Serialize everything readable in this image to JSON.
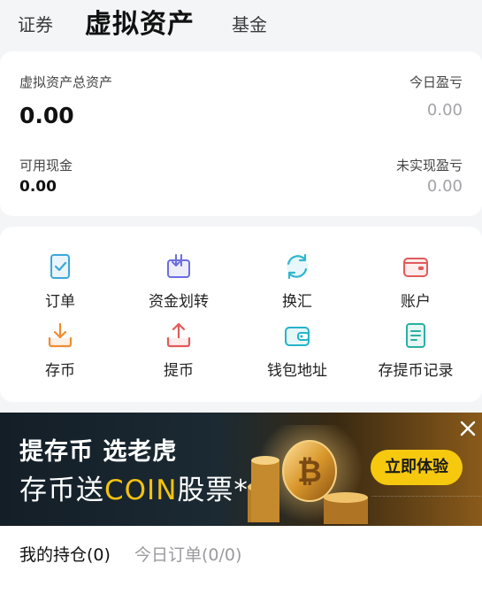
{
  "tabs": {
    "securities": "证券",
    "virtual_assets": "虚拟资产",
    "funds": "基金"
  },
  "summary": {
    "total_assets_label": "虚拟资产总资产",
    "total_assets_value": "0.00",
    "today_pnl_label": "今日盈亏",
    "today_pnl_value": "0.00",
    "cash_label": "可用现金",
    "cash_value": "0.00",
    "unrealized_pnl_label": "未实现盈亏",
    "unrealized_pnl_value": "0.00"
  },
  "functions": [
    {
      "label": "订单",
      "icon": "order-check-icon",
      "color": "#3aa8d8"
    },
    {
      "label": "资金划转",
      "icon": "fund-transfer-icon",
      "color": "#6a6ee0"
    },
    {
      "label": "换汇",
      "icon": "exchange-icon",
      "color": "#33b6d0"
    },
    {
      "label": "账户",
      "icon": "wallet-account-icon",
      "color": "#e25a5a"
    },
    {
      "label": "存币",
      "icon": "deposit-icon",
      "color": "#f08c32"
    },
    {
      "label": "提币",
      "icon": "withdraw-icon",
      "color": "#e25a5a"
    },
    {
      "label": "钱包地址",
      "icon": "wallet-address-icon",
      "color": "#22b5c8"
    },
    {
      "label": "存提币记录",
      "icon": "record-list-icon",
      "color": "#2ab0a2"
    }
  ],
  "banner": {
    "line1": "提存币 选老虎",
    "line2_prefix": "存币送",
    "line2_highlight": "COIN",
    "line2_suffix": "股票*",
    "button": "立即体验",
    "close_icon": "close-icon"
  },
  "positions": {
    "holdings_tab": "我的持仓(0)",
    "today_orders_tab": "今日订单(0/0)"
  }
}
